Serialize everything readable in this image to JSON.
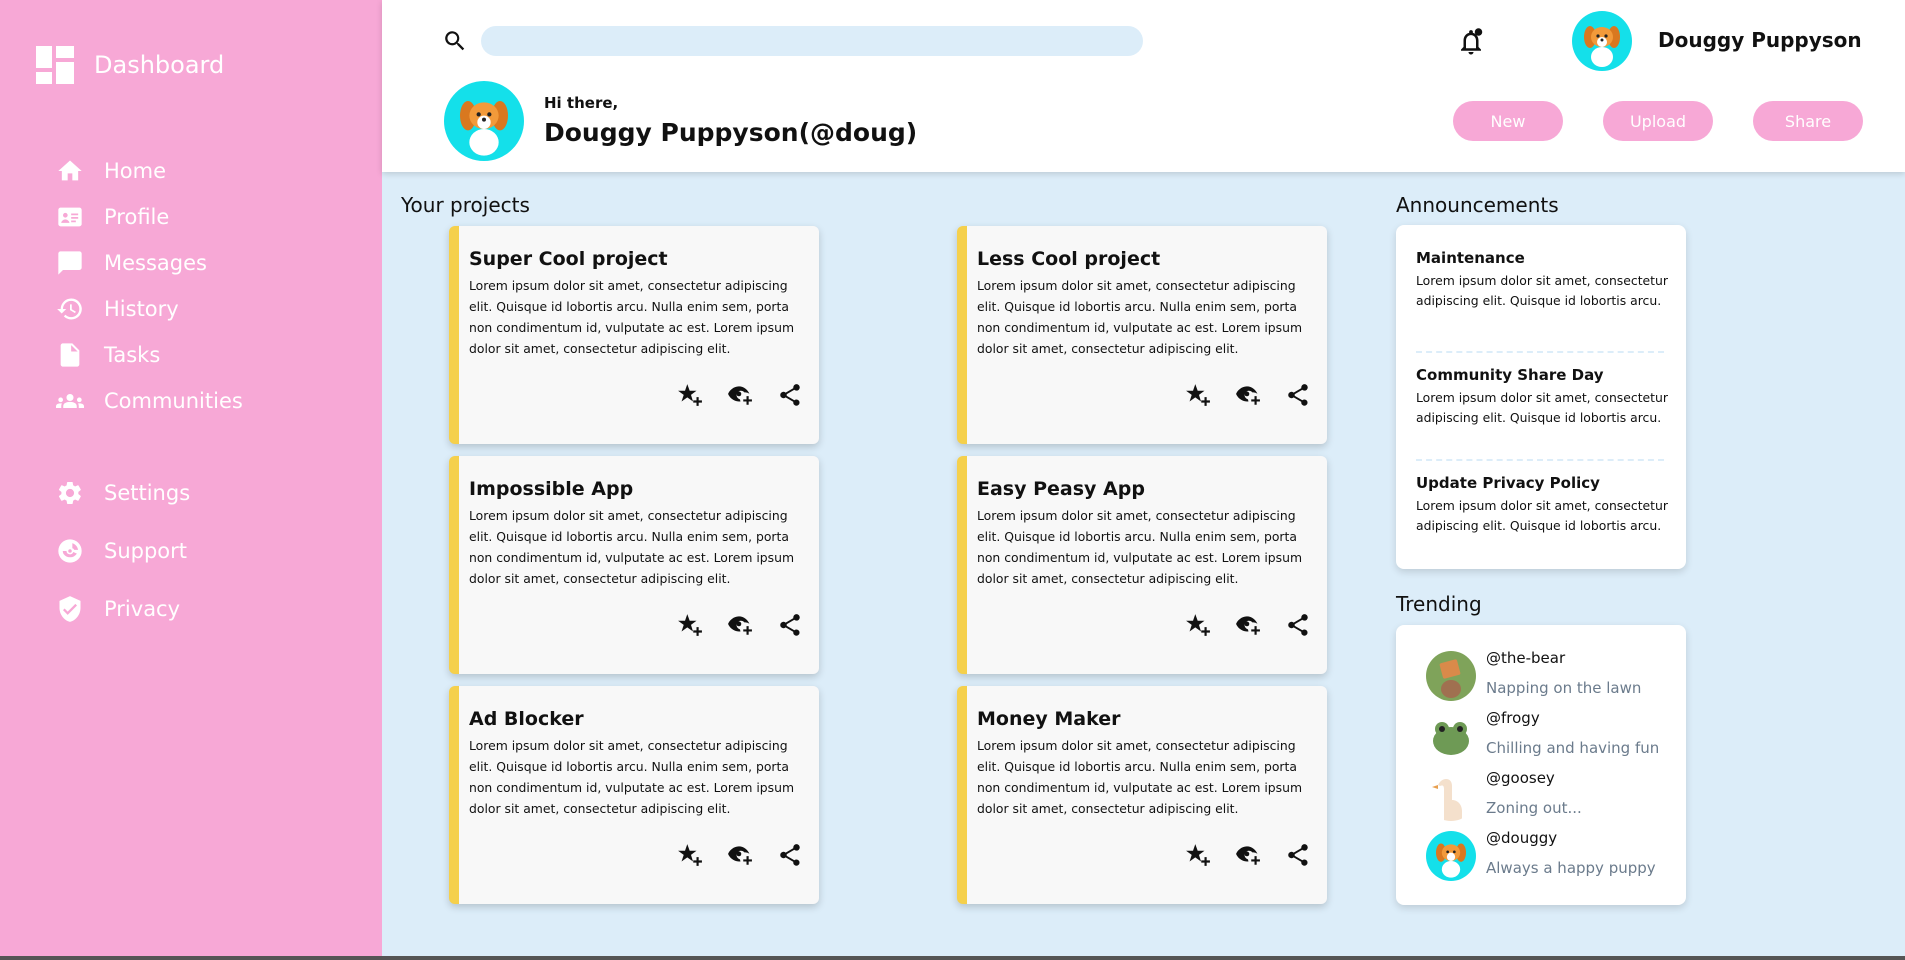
{
  "sidebar": {
    "brand": "Dashboard",
    "items": [
      {
        "label": "Home",
        "icon": "home-icon"
      },
      {
        "label": "Profile",
        "icon": "profile-card-icon"
      },
      {
        "label": "Messages",
        "icon": "message-icon"
      },
      {
        "label": "History",
        "icon": "history-icon"
      },
      {
        "label": "Tasks",
        "icon": "document-icon"
      },
      {
        "label": "Communities",
        "icon": "group-icon"
      }
    ],
    "secondary": [
      {
        "label": "Settings",
        "icon": "gear-icon"
      },
      {
        "label": "Support",
        "icon": "support-icon"
      },
      {
        "label": "Privacy",
        "icon": "shield-icon"
      }
    ]
  },
  "header": {
    "search_placeholder": "",
    "user_name": "Douggy Puppyson",
    "greeting": "Hi there,",
    "greeting_name": "Douggy Puppyson(@doug)",
    "buttons": {
      "new": "New",
      "upload": "Upload",
      "share": "Share"
    }
  },
  "projects": {
    "title": "Your projects",
    "items": [
      {
        "title": "Super Cool project",
        "desc": "Lorem ipsum dolor sit amet, consectetur adipiscing elit. Quisque id lobortis arcu. Nulla enim sem, porta non condimentum id, vulputate ac est. Lorem ipsum dolor sit amet, consectetur adipiscing elit."
      },
      {
        "title": "Less Cool project",
        "desc": "Lorem ipsum dolor sit amet, consectetur adipiscing elit. Quisque id lobortis arcu. Nulla enim sem, porta non condimentum id, vulputate ac est. Lorem ipsum dolor sit amet, consectetur adipiscing elit."
      },
      {
        "title": "Impossible App",
        "desc": "Lorem ipsum dolor sit amet, consectetur adipiscing elit. Quisque id lobortis arcu. Nulla enim sem, porta non condimentum id, vulputate ac est. Lorem ipsum dolor sit amet, consectetur adipiscing elit."
      },
      {
        "title": "Easy Peasy App",
        "desc": "Lorem ipsum dolor sit amet, consectetur adipiscing elit. Quisque id lobortis arcu. Nulla enim sem, porta non condimentum id, vulputate ac est. Lorem ipsum dolor sit amet, consectetur adipiscing elit."
      },
      {
        "title": "Ad Blocker",
        "desc": "Lorem ipsum dolor sit amet, consectetur adipiscing elit. Quisque id lobortis arcu. Nulla enim sem, porta non condimentum id, vulputate ac est. Lorem ipsum dolor sit amet, consectetur adipiscing elit."
      },
      {
        "title": "Money Maker",
        "desc": "Lorem ipsum dolor sit amet, consectetur adipiscing elit. Quisque id lobortis arcu. Nulla enim sem, porta non condimentum id, vulputate ac est. Lorem ipsum dolor sit amet, consectetur adipiscing elit."
      }
    ],
    "action_icons": [
      "star-plus-icon",
      "watch-icon",
      "share-icon"
    ]
  },
  "announcements": {
    "title": "Announcements",
    "items": [
      {
        "title": "Maintenance",
        "text": "Lorem ipsum dolor sit amet, consectetur adipiscing elit. Quisque id lobortis arcu."
      },
      {
        "title": "Community Share Day",
        "text": "Lorem ipsum dolor sit amet, consectetur adipiscing elit. Quisque id lobortis arcu."
      },
      {
        "title": "Update Privacy Policy",
        "text": "Lorem ipsum dolor sit amet, consectetur adipiscing elit. Quisque id lobortis arcu."
      }
    ]
  },
  "trending": {
    "title": "Trending",
    "items": [
      {
        "handle": "@the-bear",
        "status": "Napping on the lawn"
      },
      {
        "handle": "@frogy",
        "status": "Chilling and having fun"
      },
      {
        "handle": "@goosey",
        "status": "Zoning out..."
      },
      {
        "handle": "@douggy",
        "status": "Always a happy puppy"
      }
    ]
  },
  "colors": {
    "sidebar": "#f7a8d6",
    "accent_bar": "#f5d04c",
    "background": "#dcedf9",
    "avatar_bg": "#14e0ea"
  }
}
